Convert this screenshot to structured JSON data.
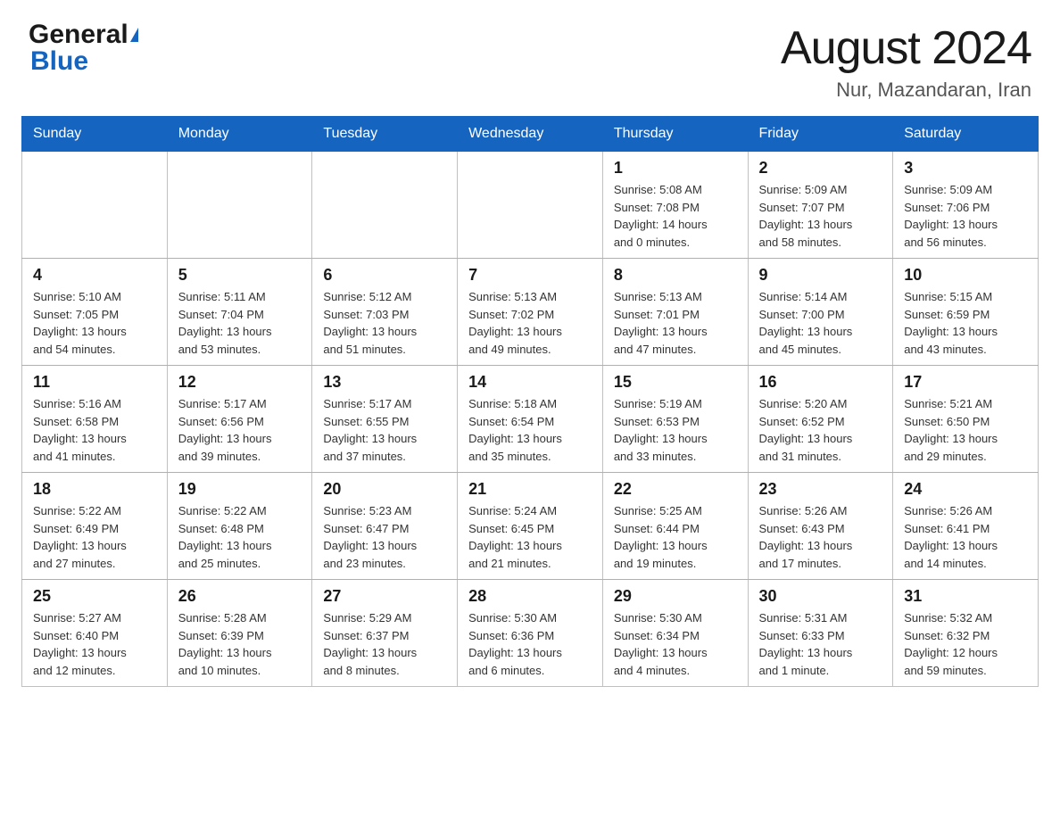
{
  "header": {
    "logo_general": "General",
    "logo_blue": "Blue",
    "month_title": "August 2024",
    "location": "Nur, Mazandaran, Iran"
  },
  "days_of_week": [
    "Sunday",
    "Monday",
    "Tuesday",
    "Wednesday",
    "Thursday",
    "Friday",
    "Saturday"
  ],
  "weeks": [
    [
      {
        "day": "",
        "info": ""
      },
      {
        "day": "",
        "info": ""
      },
      {
        "day": "",
        "info": ""
      },
      {
        "day": "",
        "info": ""
      },
      {
        "day": "1",
        "info": "Sunrise: 5:08 AM\nSunset: 7:08 PM\nDaylight: 14 hours\nand 0 minutes."
      },
      {
        "day": "2",
        "info": "Sunrise: 5:09 AM\nSunset: 7:07 PM\nDaylight: 13 hours\nand 58 minutes."
      },
      {
        "day": "3",
        "info": "Sunrise: 5:09 AM\nSunset: 7:06 PM\nDaylight: 13 hours\nand 56 minutes."
      }
    ],
    [
      {
        "day": "4",
        "info": "Sunrise: 5:10 AM\nSunset: 7:05 PM\nDaylight: 13 hours\nand 54 minutes."
      },
      {
        "day": "5",
        "info": "Sunrise: 5:11 AM\nSunset: 7:04 PM\nDaylight: 13 hours\nand 53 minutes."
      },
      {
        "day": "6",
        "info": "Sunrise: 5:12 AM\nSunset: 7:03 PM\nDaylight: 13 hours\nand 51 minutes."
      },
      {
        "day": "7",
        "info": "Sunrise: 5:13 AM\nSunset: 7:02 PM\nDaylight: 13 hours\nand 49 minutes."
      },
      {
        "day": "8",
        "info": "Sunrise: 5:13 AM\nSunset: 7:01 PM\nDaylight: 13 hours\nand 47 minutes."
      },
      {
        "day": "9",
        "info": "Sunrise: 5:14 AM\nSunset: 7:00 PM\nDaylight: 13 hours\nand 45 minutes."
      },
      {
        "day": "10",
        "info": "Sunrise: 5:15 AM\nSunset: 6:59 PM\nDaylight: 13 hours\nand 43 minutes."
      }
    ],
    [
      {
        "day": "11",
        "info": "Sunrise: 5:16 AM\nSunset: 6:58 PM\nDaylight: 13 hours\nand 41 minutes."
      },
      {
        "day": "12",
        "info": "Sunrise: 5:17 AM\nSunset: 6:56 PM\nDaylight: 13 hours\nand 39 minutes."
      },
      {
        "day": "13",
        "info": "Sunrise: 5:17 AM\nSunset: 6:55 PM\nDaylight: 13 hours\nand 37 minutes."
      },
      {
        "day": "14",
        "info": "Sunrise: 5:18 AM\nSunset: 6:54 PM\nDaylight: 13 hours\nand 35 minutes."
      },
      {
        "day": "15",
        "info": "Sunrise: 5:19 AM\nSunset: 6:53 PM\nDaylight: 13 hours\nand 33 minutes."
      },
      {
        "day": "16",
        "info": "Sunrise: 5:20 AM\nSunset: 6:52 PM\nDaylight: 13 hours\nand 31 minutes."
      },
      {
        "day": "17",
        "info": "Sunrise: 5:21 AM\nSunset: 6:50 PM\nDaylight: 13 hours\nand 29 minutes."
      }
    ],
    [
      {
        "day": "18",
        "info": "Sunrise: 5:22 AM\nSunset: 6:49 PM\nDaylight: 13 hours\nand 27 minutes."
      },
      {
        "day": "19",
        "info": "Sunrise: 5:22 AM\nSunset: 6:48 PM\nDaylight: 13 hours\nand 25 minutes."
      },
      {
        "day": "20",
        "info": "Sunrise: 5:23 AM\nSunset: 6:47 PM\nDaylight: 13 hours\nand 23 minutes."
      },
      {
        "day": "21",
        "info": "Sunrise: 5:24 AM\nSunset: 6:45 PM\nDaylight: 13 hours\nand 21 minutes."
      },
      {
        "day": "22",
        "info": "Sunrise: 5:25 AM\nSunset: 6:44 PM\nDaylight: 13 hours\nand 19 minutes."
      },
      {
        "day": "23",
        "info": "Sunrise: 5:26 AM\nSunset: 6:43 PM\nDaylight: 13 hours\nand 17 minutes."
      },
      {
        "day": "24",
        "info": "Sunrise: 5:26 AM\nSunset: 6:41 PM\nDaylight: 13 hours\nand 14 minutes."
      }
    ],
    [
      {
        "day": "25",
        "info": "Sunrise: 5:27 AM\nSunset: 6:40 PM\nDaylight: 13 hours\nand 12 minutes."
      },
      {
        "day": "26",
        "info": "Sunrise: 5:28 AM\nSunset: 6:39 PM\nDaylight: 13 hours\nand 10 minutes."
      },
      {
        "day": "27",
        "info": "Sunrise: 5:29 AM\nSunset: 6:37 PM\nDaylight: 13 hours\nand 8 minutes."
      },
      {
        "day": "28",
        "info": "Sunrise: 5:30 AM\nSunset: 6:36 PM\nDaylight: 13 hours\nand 6 minutes."
      },
      {
        "day": "29",
        "info": "Sunrise: 5:30 AM\nSunset: 6:34 PM\nDaylight: 13 hours\nand 4 minutes."
      },
      {
        "day": "30",
        "info": "Sunrise: 5:31 AM\nSunset: 6:33 PM\nDaylight: 13 hours\nand 1 minute."
      },
      {
        "day": "31",
        "info": "Sunrise: 5:32 AM\nSunset: 6:32 PM\nDaylight: 12 hours\nand 59 minutes."
      }
    ]
  ]
}
